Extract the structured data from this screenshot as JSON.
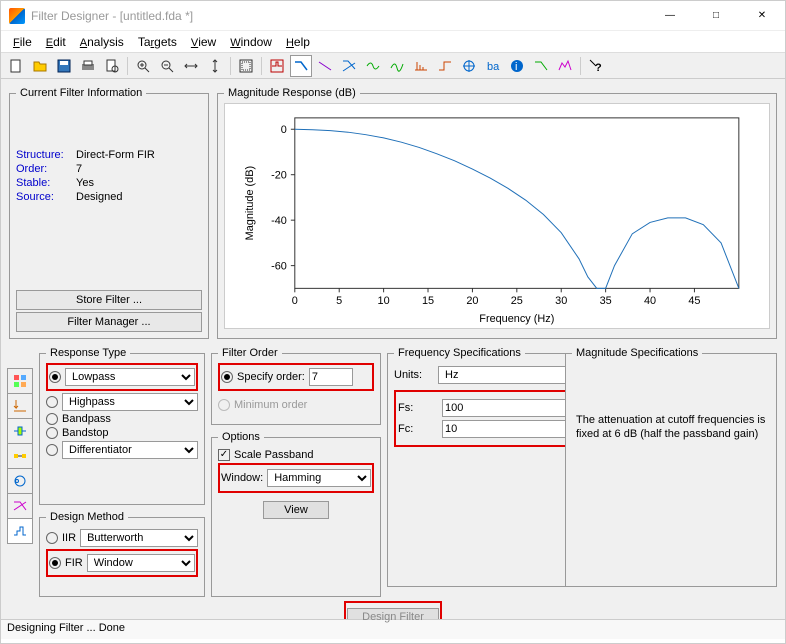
{
  "window": {
    "title": "Filter Designer -  [untitled.fda *]",
    "min": "—",
    "max": "□",
    "close": "✕"
  },
  "menu": {
    "file": "File",
    "edit": "Edit",
    "analysis": "Analysis",
    "targets": "Targets",
    "view": "View",
    "window": "Window",
    "help": "Help"
  },
  "filterinfo": {
    "legend": "Current Filter Information",
    "structure_l": "Structure:",
    "structure_v": "Direct-Form FIR",
    "order_l": "Order:",
    "order_v": "7",
    "stable_l": "Stable:",
    "stable_v": "Yes",
    "source_l": "Source:",
    "source_v": "Designed",
    "store": "Store Filter ...",
    "manager": "Filter Manager ..."
  },
  "magresp": {
    "legend": "Magnitude Response (dB)",
    "ylabel": "Magnitude (dB)",
    "xlabel": "Frequency (Hz)"
  },
  "chart_data": {
    "type": "line",
    "title": "Magnitude Response (dB)",
    "xlabel": "Frequency (Hz)",
    "ylabel": "Magnitude (dB)",
    "xlim": [
      0,
      50
    ],
    "ylim": [
      -70,
      5
    ],
    "xticks": [
      0,
      5,
      10,
      15,
      20,
      25,
      30,
      35,
      40,
      45
    ],
    "yticks": [
      0,
      -20,
      -40,
      -60
    ],
    "series": [
      {
        "name": "Magnitude",
        "x": [
          0,
          2,
          4,
          6,
          8,
          10,
          12,
          14,
          16,
          18,
          20,
          22,
          24,
          26,
          28,
          30,
          32,
          33,
          34,
          35,
          36,
          38,
          40,
          42,
          44,
          46,
          48,
          50
        ],
        "y": [
          0,
          -0.2,
          -0.6,
          -1.3,
          -2.4,
          -3.8,
          -5.7,
          -8.0,
          -10.8,
          -13.9,
          -17.5,
          -21.5,
          -26.0,
          -31.2,
          -37.5,
          -45.5,
          -57,
          -65,
          -80,
          -120,
          -60,
          -46,
          -41,
          -39,
          -39,
          -42,
          -50,
          -80
        ]
      }
    ]
  },
  "resptype": {
    "legend": "Response Type",
    "lowpass": "Lowpass",
    "highpass": "Highpass",
    "bandpass": "Bandpass",
    "bandstop": "Bandstop",
    "diff": "Differentiator"
  },
  "designmethod": {
    "legend": "Design Method",
    "iir": "IIR",
    "iir_sel": "Butterworth",
    "fir": "FIR",
    "fir_sel": "Window"
  },
  "filterorder": {
    "legend": "Filter Order",
    "specify": "Specify order:",
    "specify_v": "7",
    "min": "Minimum order"
  },
  "options": {
    "legend": "Options",
    "scale": "Scale Passband",
    "window_l": "Window:",
    "window_v": "Hamming",
    "view": "View"
  },
  "freqspec": {
    "legend": "Frequency Specifications",
    "units_l": "Units:",
    "units_v": "Hz",
    "fs_l": "Fs:",
    "fs_v": "100",
    "fc_l": "Fc:",
    "fc_v": "10"
  },
  "magspec": {
    "legend": "Magnitude Specifications",
    "text": "The attenuation at cutoff frequencies is fixed at 6 dB (half the passband gain)"
  },
  "design_btn": "Design Filter",
  "status": "Designing Filter ... Done"
}
